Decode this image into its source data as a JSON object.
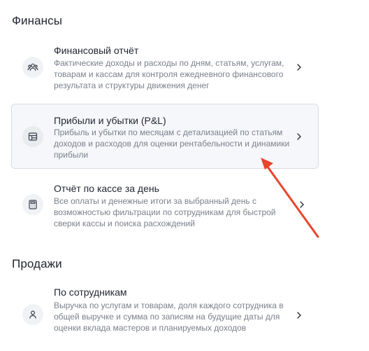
{
  "sections": {
    "finance": {
      "title": "Финансы",
      "cards": [
        {
          "title": "Финансовый отчёт",
          "description": "Фактические доходы и расходы по дням, статьям, услугам, товарам и кассам для контроля ежедневного финансового результата и структуры движения денег",
          "icon": "people-icon"
        },
        {
          "title": "Прибыли и убытки (P&L)",
          "description": "Прибыль и убытки по месяцам с детализацией по статьям доходов и расходов для оценки рентабельности и динамики прибыли",
          "icon": "table-icon"
        },
        {
          "title": "Отчёт по кассе за день",
          "description": "Все оплаты и денежные итоги за выбранный день с возможностью фильтрации по сотрудникам для быстрой сверки кассы и поиска расхождений",
          "icon": "calculator-icon"
        }
      ]
    },
    "sales": {
      "title": "Продажи",
      "cards": [
        {
          "title": "По сотрудникам",
          "description": "Выручка по услугам и товарам, доля каждого сотрудника в общей выручке и сумма по записям на будущие даты для оценки вклада мастеров и планируемых доходов",
          "icon": "user-icon"
        }
      ]
    }
  },
  "colors": {
    "annotation_arrow": "#e8452c",
    "active_card_bg": "#f6f7fa"
  }
}
